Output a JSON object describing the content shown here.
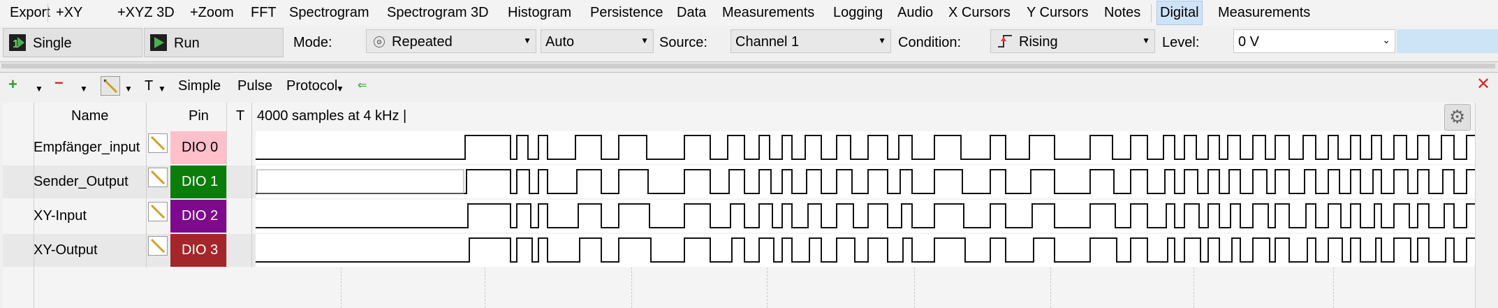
{
  "menu": {
    "items": [
      "Export",
      "+XY",
      "+XYZ 3D",
      "+Zoom",
      "FFT",
      "Spectrogram",
      "Spectrogram 3D",
      "Histogram",
      "Persistence",
      "Data",
      "Measurements",
      "Logging",
      "Audio",
      "X Cursors",
      "Y Cursors",
      "Notes",
      "Digital",
      "Measurements"
    ],
    "active": "Digital"
  },
  "toolbar": {
    "single_label": "Single",
    "run_label": "Run",
    "mode_label": "Mode:",
    "mode_value": "Repeated",
    "auto_value": "Auto",
    "source_label": "Source:",
    "source_value": "Channel 1",
    "condition_label": "Condition:",
    "condition_value": "Rising",
    "level_label": "Level:",
    "level_value": "0 V"
  },
  "digital_toolbar": {
    "t_label": "T",
    "simple_label": "Simple",
    "pulse_label": "Pulse",
    "protocol_label": "Protocol"
  },
  "table": {
    "header_name": "Name",
    "header_pin": "Pin",
    "header_t": "T",
    "samples_info": "4000 samples at 4 kHz |",
    "rows": [
      {
        "name": "Empfänger_input",
        "pin": "DIO  0",
        "pin_color": "#ffc0cb",
        "pin_text_color": "#000000"
      },
      {
        "name": "Sender_Output",
        "pin": "DIO  1",
        "pin_color": "#0a7d0a",
        "pin_text_color": "#ffffff"
      },
      {
        "name": "XY-Input",
        "pin": "DIO  2",
        "pin_color": "#7d0a8c",
        "pin_text_color": "#ffffff"
      },
      {
        "name": "XY-Output",
        "pin": "DIO  3",
        "pin_color": "#a3262a",
        "pin_text_color": "#ffffff"
      }
    ]
  },
  "colors": {
    "active_menu": "#cfe3f7",
    "trigger_icon": "#e23b2b",
    "add_icon": "#2e9a2e",
    "remove_icon": "#d12c2c"
  }
}
